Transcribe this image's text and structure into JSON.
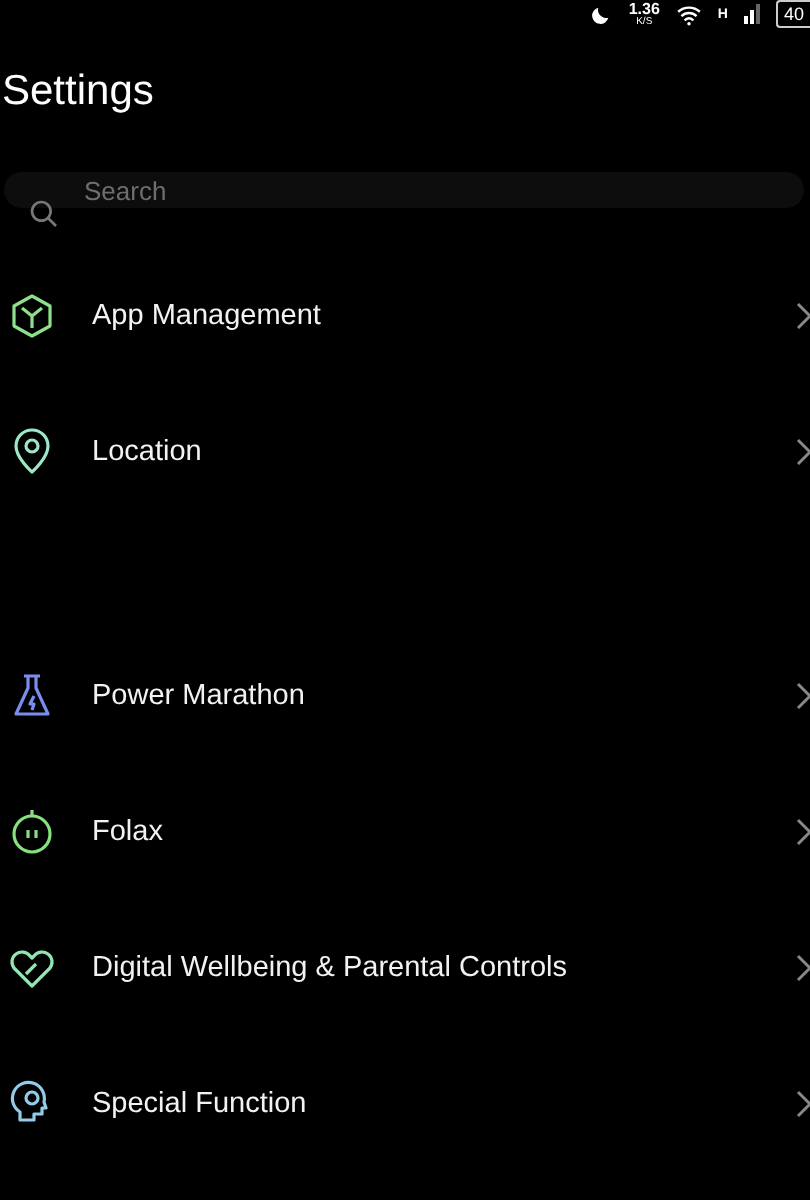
{
  "status_bar": {
    "speed_value": "1.36",
    "speed_unit": "K/S",
    "network": "H",
    "battery": "40"
  },
  "title": "Settings",
  "search": {
    "placeholder": "Search"
  },
  "groups": [
    {
      "items": [
        {
          "label": "App Management",
          "color": "#8fe08a"
        },
        {
          "label": "Location",
          "color": "#9ce8c4"
        }
      ]
    },
    {
      "items": [
        {
          "label": "Power Marathon",
          "color": "#7a8ef0"
        },
        {
          "label": "Folax",
          "color": "#86e07e"
        },
        {
          "label": "Digital Wellbeing & Parental Controls",
          "color": "#92e6b4"
        },
        {
          "label": "Special Function",
          "color": "#92cce8"
        }
      ]
    }
  ]
}
